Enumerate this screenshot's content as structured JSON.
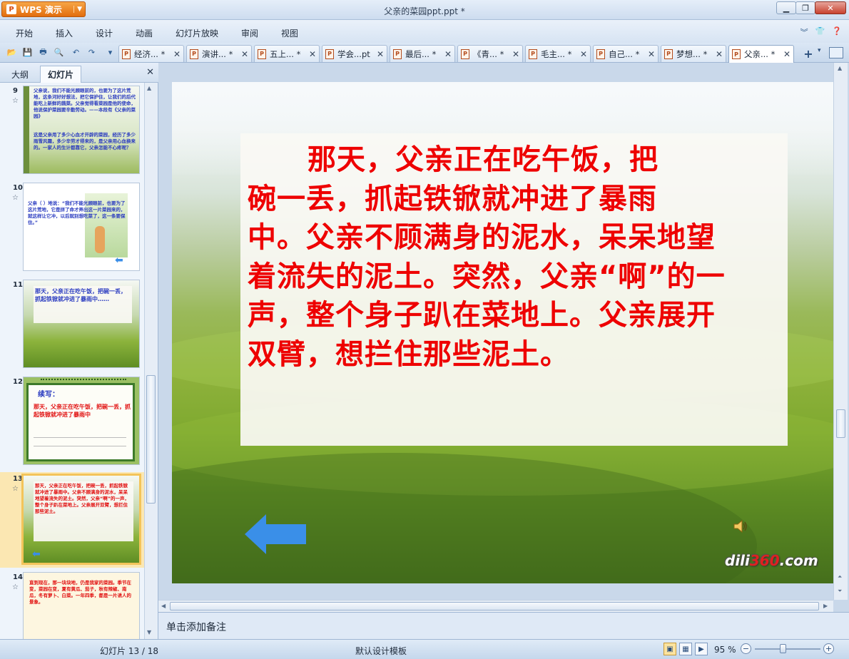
{
  "titlebar": {
    "app_button": "WPS 演示",
    "window_title": "父亲的菜园ppt.ppt *",
    "minimize": "▁",
    "restore": "❐",
    "close": "✕"
  },
  "menu": {
    "items": [
      "开始",
      "插入",
      "设计",
      "动画",
      "幻灯片放映",
      "审阅",
      "视图"
    ]
  },
  "doc_tabs": [
    {
      "label": "经济... *"
    },
    {
      "label": "演讲... *"
    },
    {
      "label": "五上... *"
    },
    {
      "label": "学会...pt"
    },
    {
      "label": "最后... *"
    },
    {
      "label": "《青... *"
    },
    {
      "label": "毛主... *"
    },
    {
      "label": "自己... *"
    },
    {
      "label": "梦想... *"
    },
    {
      "label": "父亲... *"
    }
  ],
  "panel": {
    "tab_outline": "大纲",
    "tab_slides": "幻灯片",
    "close": "✕"
  },
  "thumbnails": [
    {
      "number": "9",
      "text_blue": "父亲说，我们不能光顾眼前的，也要为了这片荒地，这条河好好想法，把它保护住，让我们的后代能吃上新鲜的蔬菜。父亲觉得看菜园是他的使命，他说保护菜园要辛勤劳动。——本段有《父亲的菜园》",
      "text_blue2": "这是父亲用了多少心血才开辟的菜园，经历了多少雨雪风霜，多少辛劳才得来的，是父亲用心血换来的。一家人的生计都靠它，父亲怎能不心疼呢？"
    },
    {
      "number": "10",
      "text": "父亲（ ）地说：“我们不能光顾眼前，也要为了这片荒地，它是拼了命才弄出这一片菜园来的，就这样让它冲，以后就别想吃菜了，这一条要保住。”"
    },
    {
      "number": "11",
      "text": "那天，父亲正在吃午饭，把碗一丢，抓起铁锨就冲进了暴雨中……"
    },
    {
      "number": "12",
      "title": "续写：",
      "text": "那天，父亲正在吃午饭，把碗一丢，抓起铁锨就冲进了暴雨中"
    },
    {
      "number": "13",
      "text": "那天，父亲正在吃午饭，把碗一丢，抓起铁锨就冲进了暴雨中。父亲不顾满身的泥水，呆呆地望着流失的泥土。突然，父亲“啊”的一声，整个身子趴在菜地上。父亲展开双臂，想拦住那些泥土。"
    },
    {
      "number": "14",
      "text": "直到现在，那一块块地，仍是我家的菜园。季节在变，菜园在变，夏有黄瓜、茄子，秋有辣椒、南瓜，冬有萝卜、白菜。一年四季，都是一片诱人的景象。"
    }
  ],
  "slide": {
    "line1": "那天，父亲正在吃午饭，把",
    "line2": "碗一丢，抓起铁锨就冲进了暴雨",
    "line3": "中。父亲不顾满身的泥水，呆呆地望",
    "line4": "着流失的泥土。突然，父亲“啊”的一",
    "line5": "声，整个身子趴在菜地上。父亲展开",
    "line6": "双臂，想拦住那些泥土。",
    "watermark_a": "dili",
    "watermark_b": "360",
    "watermark_c": ".com"
  },
  "notes": {
    "placeholder": "单击添加备注"
  },
  "status": {
    "slide_count": "幻灯片 13 / 18",
    "template": "默认设计模板",
    "zoom": "95 %"
  },
  "colors": {
    "slide_text": "#ee0000",
    "accent": "#e26d0e"
  }
}
